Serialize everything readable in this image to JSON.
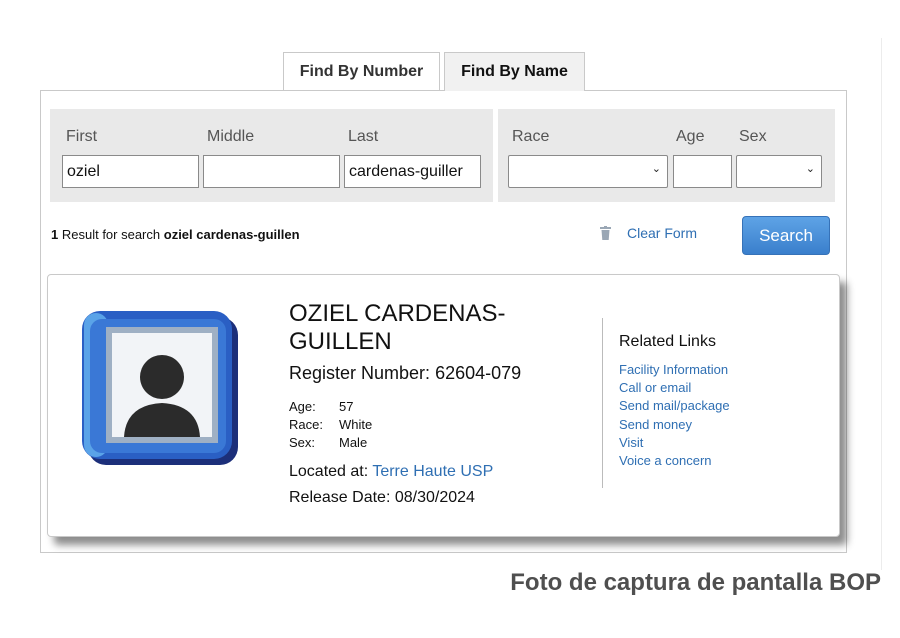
{
  "tabs": [
    {
      "label": "Find By Number",
      "active": false
    },
    {
      "label": "Find By Name",
      "active": true
    }
  ],
  "form": {
    "first_label": "First",
    "first_value": "oziel",
    "middle_label": "Middle",
    "middle_value": "",
    "last_label": "Last",
    "last_value": "cardenas-guiller",
    "race_label": "Race",
    "race_value": "",
    "age_label": "Age",
    "age_value": "",
    "sex_label": "Sex",
    "sex_value": ""
  },
  "results": {
    "count": "1",
    "text": "Result for search",
    "query": "oziel cardenas-guillen"
  },
  "actions": {
    "clear_label": "Clear Form",
    "search_label": "Search"
  },
  "inmate": {
    "name": "OZIEL CARDENAS-GUILLEN",
    "register_label": "Register Number:",
    "register_number": "62604-079",
    "age_label": "Age:",
    "age": "57",
    "race_label": "Race:",
    "race": "White",
    "sex_label": "Sex:",
    "sex": "Male",
    "located_label": "Located at:",
    "facility": "Terre Haute USP",
    "release_label": "Release Date:",
    "release_date": "08/30/2024"
  },
  "related_links": {
    "title": "Related Links",
    "items": [
      "Facility Information",
      "Call or email",
      "Send mail/package",
      "Send money",
      "Visit",
      "Voice a concern"
    ]
  },
  "caption": "Foto de captura de pantalla BOP",
  "colors": {
    "link": "#2f6fb3",
    "search_button": "#4a90d9",
    "panel_bg": "#e9e9e9",
    "avatar_frame": "#2a5fc4"
  },
  "icons": [
    "trash-icon",
    "person-avatar-icon",
    "chevron-down-icon"
  ]
}
